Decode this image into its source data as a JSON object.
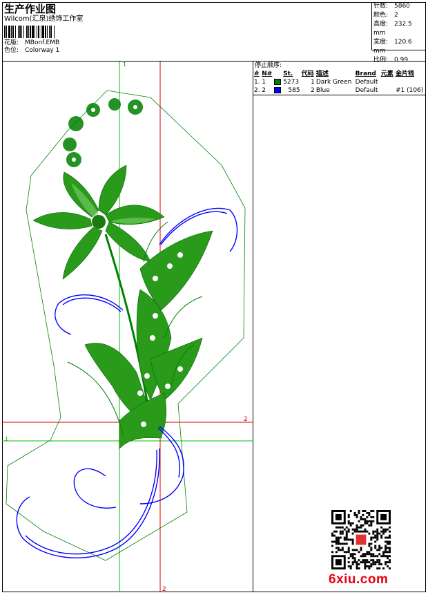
{
  "header": {
    "title": "生产作业图",
    "subtitle": "Wilcom(汇泉)绣饰工作室",
    "meta": [
      {
        "label": "花版:",
        "value": "MBonf.EMB"
      },
      {
        "label": "色位:",
        "value": "Colorway 1"
      }
    ]
  },
  "stats": [
    {
      "label": "针数:",
      "value": "5860"
    },
    {
      "label": "颜色:",
      "value": "2"
    },
    {
      "label": "高度:",
      "value": "232.5 mm"
    },
    {
      "label": "宽度:",
      "value": "120.6 mm"
    },
    {
      "label": "比例:",
      "value": "0.99"
    }
  ],
  "guides": {
    "green_v": "1",
    "green_h": "1",
    "red_v": "2",
    "red_h": "2"
  },
  "sequence": {
    "title": "停止顺序:",
    "columns": [
      "#",
      "N#",
      "St.",
      "代码",
      "描述",
      "Brand",
      "元素",
      "金片钱"
    ],
    "rows": [
      {
        "idx": "1.",
        "n": "1",
        "color": "#008000",
        "st": "5273",
        "code": "1",
        "desc": "Dark Green",
        "brand": "Default",
        "elem": "",
        "sequin": ""
      },
      {
        "idx": "2.",
        "n": "2",
        "color": "#0000ff",
        "st": "585",
        "code": "2",
        "desc": "Blue",
        "brand": "Default",
        "elem": "",
        "sequin": "#1 (106)"
      }
    ]
  },
  "colors": {
    "green": "#008000",
    "blue": "#0000ff",
    "guide_green": "#00c000",
    "guide_red": "#e00000"
  },
  "watermark": "6xiu.com"
}
